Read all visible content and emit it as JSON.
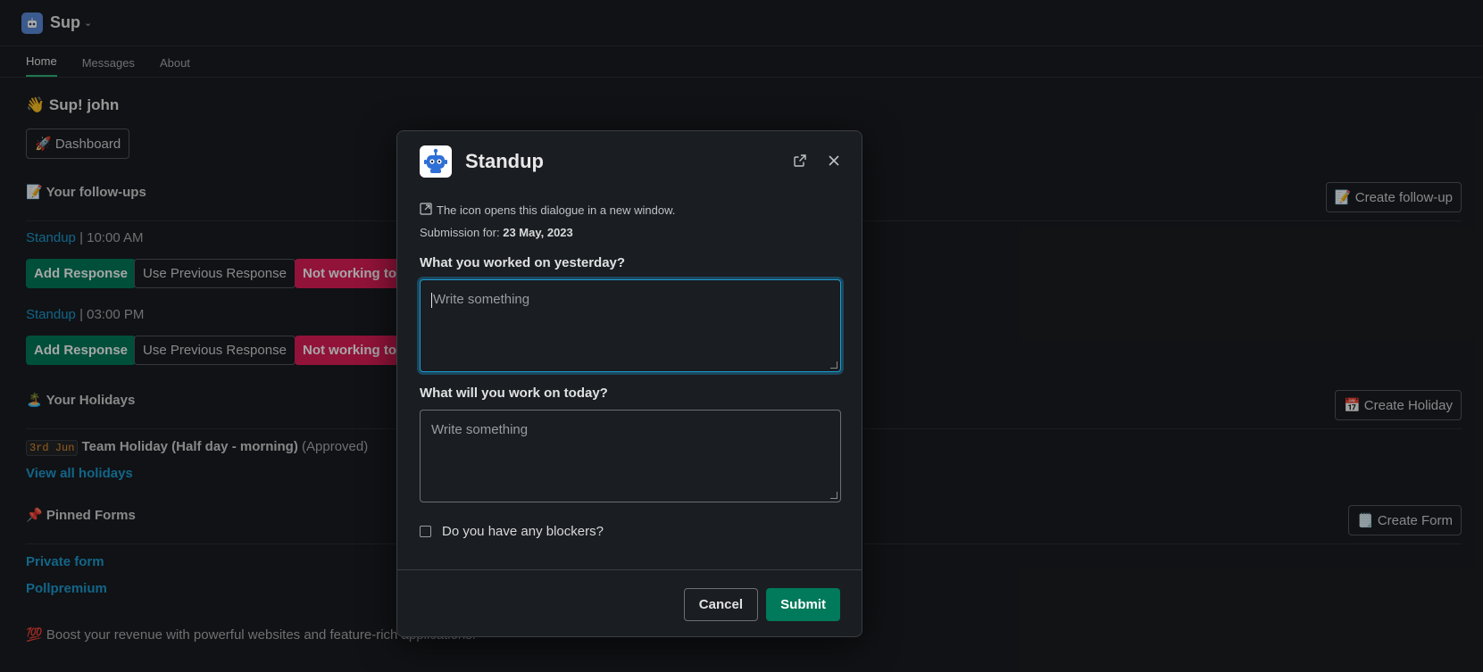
{
  "app": {
    "name": "Sup",
    "icon": "robot-icon"
  },
  "tabs": [
    {
      "label": "Home",
      "active": true
    },
    {
      "label": "Messages",
      "active": false
    },
    {
      "label": "About",
      "active": false
    }
  ],
  "home": {
    "greeting": "👋 Sup! john",
    "dashboard_button": "🚀 Dashboard",
    "followups": {
      "title": "📝 Your follow-ups",
      "create_button": "📝 Create follow-up",
      "items": [
        {
          "name": "Standup",
          "time": "| 10:00 AM",
          "add": "Add Response",
          "prev": "Use Previous Response",
          "notworking": "Not working today"
        },
        {
          "name": "Standup",
          "time": "| 03:00 PM",
          "add": "Add Response",
          "prev": "Use Previous Response",
          "notworking": "Not working today"
        }
      ]
    },
    "holidays": {
      "title": "🏝️ Your Holidays",
      "create_button": "📅 Create Holiday",
      "date": "3rd Jun",
      "name": "Team Holiday (Half day - morning)",
      "status": "(Approved)",
      "view_all": "View all holidays"
    },
    "forms": {
      "title": "📌 Pinned Forms",
      "create_button": "🗒️ Create Form",
      "items": [
        "Private form",
        "Pollpremium"
      ]
    },
    "promo": "💯 Boost your revenue with powerful websites and feature-rich applications."
  },
  "modal": {
    "title": "Standup",
    "note": "The icon opens this dialogue in a new window.",
    "submission_label": "Submission for:",
    "submission_date": "23 May, 2023",
    "q1_label": "What you worked on yesterday?",
    "q1_placeholder": "Write something",
    "q2_label": "What will you work on today?",
    "q2_placeholder": "Write something",
    "blockers_label": "Do you have any blockers?",
    "cancel": "Cancel",
    "submit": "Submit"
  },
  "colors": {
    "accent_green": "#007a5a",
    "danger": "#e01e5a",
    "link": "#1d9bd1",
    "focus": "#1d9bd1"
  }
}
